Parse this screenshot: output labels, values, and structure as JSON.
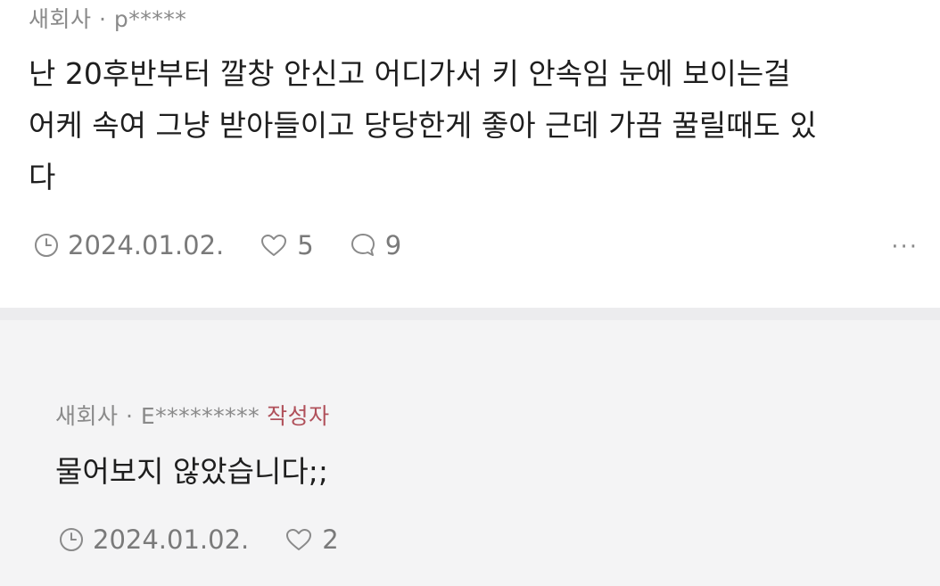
{
  "comment": {
    "author": "새회사 · p*****",
    "text": "난 20후반부터 깔창 안신고 어디가서 키 안속임 눈에 보이는걸\n어케 속여 그냥 받아들이고 당당한게 좋아 근데 가끔 꿀릴때도 있\n다",
    "date": "2024.01.02.",
    "likes": "5",
    "replies": "9",
    "more": "···"
  },
  "reply": {
    "author": "새회사 · E*********",
    "badge": "작성자",
    "text": "물어보지 않았습니다;;",
    "date": "2024.01.02.",
    "likes": "2"
  },
  "colors": {
    "meta": "#8a8a8a",
    "badge": "#b0505a",
    "band": "#f4f4f5"
  },
  "icons": {
    "time": "clock-icon",
    "like": "heart-icon",
    "reply": "speech-bubble-icon",
    "more": "more-dots-icon"
  }
}
